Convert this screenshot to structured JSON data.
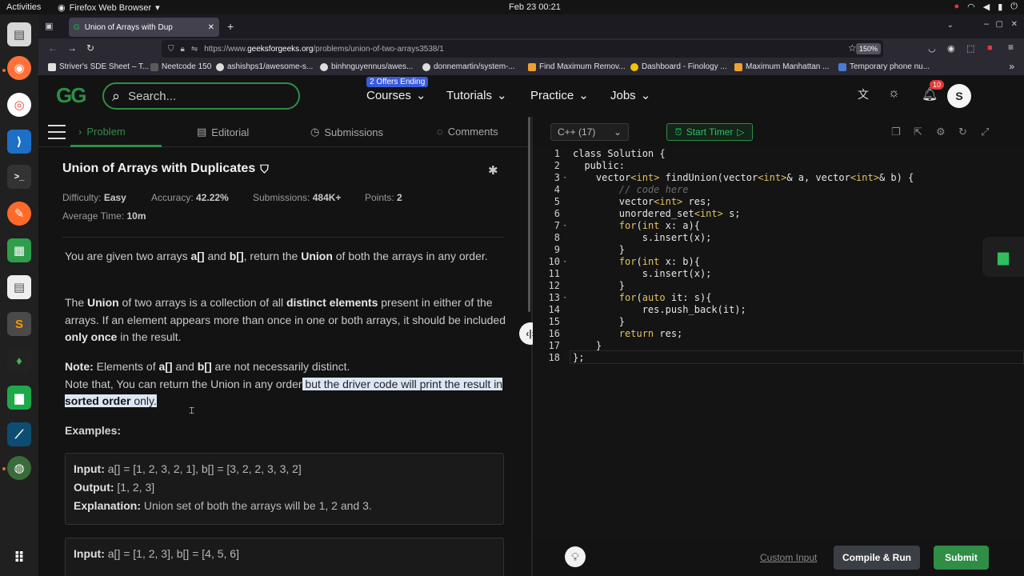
{
  "os": {
    "activities": "Activities",
    "app_name": "Firefox Web Browser",
    "clock": "Feb 23  00:21"
  },
  "browser": {
    "tab_title": "Union of Arrays with Dup",
    "url_prefix": "https://www.",
    "url_host": "geeksforgeeks.org",
    "url_path": "/problems/union-of-two-arrays3538/1",
    "zoom": "150%",
    "bookmarks": [
      {
        "label": "Striver's SDE Sheet – T...",
        "color": "#e0e0e0"
      },
      {
        "label": "Neetcode 150",
        "color": "#5a5a5a"
      },
      {
        "label": "ashishps1/awesome-s...",
        "color": "#dddddd"
      },
      {
        "label": "binhnguyennus/awes...",
        "color": "#dddddd"
      },
      {
        "label": "donnemartin/system-...",
        "color": "#dddddd"
      },
      {
        "label": "Find Maximum Remov...",
        "color": "#f0a030"
      },
      {
        "label": "Dashboard - Finology ...",
        "color": "#f2c200"
      },
      {
        "label": "Maximum Manhattan ...",
        "color": "#f0a030"
      },
      {
        "label": "Temporary phone nu...",
        "color": "#4a7bd0"
      }
    ]
  },
  "site": {
    "logo": "GG",
    "search_placeholder": "Search...",
    "offer_badge": "2 Offers Ending",
    "nav": [
      "Courses",
      "Tutorials",
      "Practice",
      "Jobs"
    ],
    "notification_count": "10",
    "avatar_letter": "S",
    "accent": "#2f8d46"
  },
  "problem_tabs": {
    "problem": "Problem",
    "editorial": "Editorial",
    "submissions": "Submissions",
    "comments": "Comments"
  },
  "problem": {
    "title": "Union of Arrays with Duplicates",
    "difficulty_label": "Difficulty:",
    "difficulty": "Easy",
    "accuracy_label": "Accuracy:",
    "accuracy": "42.22%",
    "submissions_label": "Submissions:",
    "submissions": "484K+",
    "points_label": "Points:",
    "points": "2",
    "avg_time_label": "Average Time:",
    "avg_time": "10m",
    "p1_a": "You are given two arrays ",
    "p1_b": "a[]",
    "p1_c": " and ",
    "p1_d": "b[]",
    "p1_e": ", return the ",
    "p1_f": "Union",
    "p1_g": " of both the arrays in any order.",
    "p2_a": "The ",
    "p2_b": "Union",
    "p2_c": " of two arrays is a collection of all ",
    "p2_d": "distinct elements",
    "p2_e": " present in either of the arrays. If an element appears more than once in one or both arrays, it should be included ",
    "p2_f": "only once",
    "p2_g": " in the result.",
    "note_label": "Note:",
    "note_a": " Elements of ",
    "note_b": "a[]",
    "note_c": " and ",
    "note_d": "b[]",
    "note_e": " are not necessarily distinct.",
    "note2_a": "Note that, You can return the Union in any order",
    "note2_b": " but the driver code will print the result in ",
    "note2_c": "sorted order",
    "note2_d": " only.",
    "examples_label": "Examples:",
    "ex1_input_label": "Input:",
    "ex1_input": " a[] = [1, 2, 3, 2, 1], b[] = [3, 2, 2, 3, 3, 2]",
    "ex1_output_label": "Output:",
    "ex1_output": " [1, 2, 3]",
    "ex1_expl_label": "Explanation:",
    "ex1_expl": " Union set of both the arrays will be 1, 2 and 3.",
    "ex2_input_label": "Input:",
    "ex2_input": " a[] = [1, 2, 3], b[] = [4, 5, 6]"
  },
  "editor": {
    "language": "C++ (17)",
    "timer": "Start Timer",
    "custom_input": "Custom Input",
    "compile_run": "Compile & Run",
    "submit": "Submit"
  }
}
